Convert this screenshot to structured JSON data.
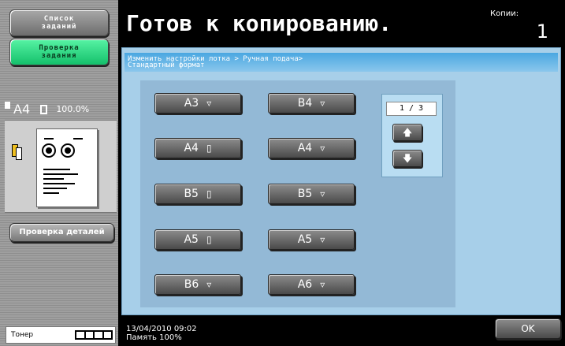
{
  "sidebar": {
    "jobs_label": "Список\nзаданий",
    "check_label": "Проверка\nзадания",
    "paper_size": "A4",
    "zoom": "100.0%",
    "details_label": "Проверка деталей",
    "toner_label": "Тонер"
  },
  "header": {
    "title": "Готов к копированию.",
    "copies_label": "Копии:",
    "copies_value": "1"
  },
  "breadcrumb": "Изменить настройки лотка > Ручная подача>\nСтандартный формат",
  "paper_sizes": [
    {
      "label": "A3",
      "orientation": "landscape"
    },
    {
      "label": "B4",
      "orientation": "landscape"
    },
    {
      "label": "A4",
      "orientation": "portrait"
    },
    {
      "label": "A4",
      "orientation": "landscape"
    },
    {
      "label": "B5",
      "orientation": "portrait"
    },
    {
      "label": "B5",
      "orientation": "landscape"
    },
    {
      "label": "A5",
      "orientation": "portrait"
    },
    {
      "label": "A5",
      "orientation": "landscape"
    },
    {
      "label": "B6",
      "orientation": "landscape"
    },
    {
      "label": "A6",
      "orientation": "landscape"
    }
  ],
  "pager": {
    "indicator": "1 / 3"
  },
  "status": {
    "datetime": "13/04/2010    09:02",
    "memory": "Память        100%"
  },
  "ok_label": "OK"
}
